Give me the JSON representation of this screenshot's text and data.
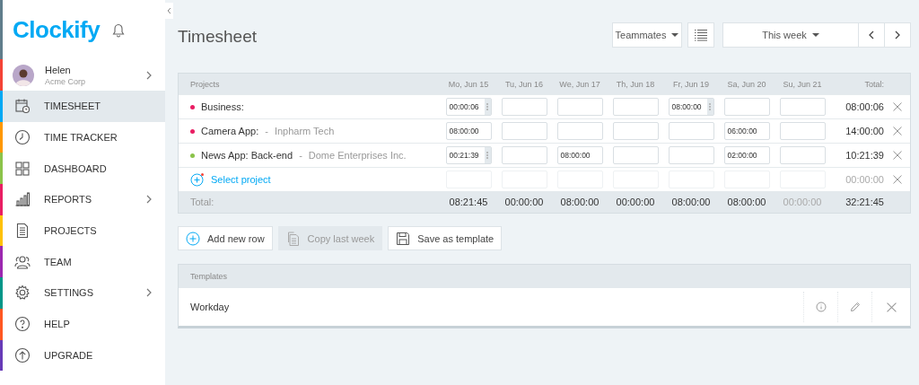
{
  "logo": {
    "text": "Clockify"
  },
  "user": {
    "name": "Helen",
    "company": "Acme Corp"
  },
  "nav": [
    {
      "label": "TIMESHEET",
      "selected": true,
      "submenu": false,
      "color": "#03a9f4"
    },
    {
      "label": "TIME TRACKER",
      "selected": false,
      "submenu": false,
      "color": "#ff9800"
    },
    {
      "label": "DASHBOARD",
      "selected": false,
      "submenu": false,
      "color": "#8bc34a"
    },
    {
      "label": "REPORTS",
      "selected": false,
      "submenu": true,
      "color": "#e91e63"
    },
    {
      "label": "PROJECTS",
      "selected": false,
      "submenu": false,
      "color": "#ffc107"
    },
    {
      "label": "TEAM",
      "selected": false,
      "submenu": false,
      "color": "#9c27b0"
    },
    {
      "label": "SETTINGS",
      "selected": false,
      "submenu": true,
      "color": "#009688"
    },
    {
      "label": "HELP",
      "selected": false,
      "submenu": false,
      "color": "#ff5722"
    },
    {
      "label": "UPGRADE",
      "selected": false,
      "submenu": false,
      "color": "#673ab7"
    }
  ],
  "page": {
    "title": "Timesheet"
  },
  "toolbar": {
    "filter": "Teammates",
    "range": "This week"
  },
  "table": {
    "project_header": "Projects",
    "days": [
      "Mo, Jun 15",
      "Tu, Jun 16",
      "We, Jun 17",
      "Th, Jun 18",
      "Fr, Jun 19",
      "Sa, Jun 20",
      "Su, Jun 21"
    ],
    "total_header": "Total:",
    "rows": [
      {
        "kind": "project",
        "name": "Business:",
        "color": "#e91e63",
        "total": "08:00:06",
        "cells": [
          {
            "value": "00:00:06",
            "stepper": true
          },
          {
            "stepper": false
          },
          {
            "stepper": false
          },
          {
            "stepper": false
          },
          {
            "value": "08:00:00",
            "stepper": true
          },
          {
            "stepper": false
          },
          {
            "stepper": false
          }
        ]
      },
      {
        "kind": "project",
        "name": "Camera App:",
        "separator": "-",
        "client": "Inpharm Tech",
        "color": "#e91e63",
        "total": "14:00:00",
        "cells": [
          {
            "value": "08:00:00",
            "stepper": false
          },
          {
            "stepper": false
          },
          {
            "stepper": false
          },
          {
            "stepper": false
          },
          {
            "stepper": false
          },
          {
            "value": "06:00:00",
            "stepper": false
          },
          {
            "stepper": false
          }
        ]
      },
      {
        "kind": "project",
        "name": "News App: Back-end",
        "separator": "-",
        "client": "Dome Enterprises Inc.",
        "color": "#8bc34a",
        "total": "10:21:39",
        "cells": [
          {
            "value": "00:21:39",
            "stepper": true
          },
          {
            "stepper": false
          },
          {
            "value": "08:00:00",
            "stepper": false
          },
          {
            "stepper": false
          },
          {
            "stepper": false
          },
          {
            "value": "02:00:00",
            "stepper": false
          },
          {
            "stepper": false
          }
        ]
      },
      {
        "kind": "select",
        "name": "Select project",
        "total": "00:00:00",
        "cells": [
          {
            "stepper": false
          },
          {
            "stepper": false
          },
          {
            "stepper": false
          },
          {
            "stepper": false
          },
          {
            "stepper": false
          },
          {
            "stepper": false
          },
          {
            "stepper": false
          }
        ]
      }
    ],
    "totals_label": "Total:",
    "totals": [
      {
        "value": "08:21:45",
        "muted": false
      },
      {
        "value": "00:00:00",
        "muted": false
      },
      {
        "value": "08:00:00",
        "muted": false
      },
      {
        "value": "00:00:00",
        "muted": false
      },
      {
        "value": "08:00:00",
        "muted": false
      },
      {
        "value": "08:00:00",
        "muted": false
      },
      {
        "value": "00:00:00",
        "muted": true
      }
    ],
    "grand_total": "32:21:45"
  },
  "actions": [
    {
      "label": "Add new row",
      "disabled": false
    },
    {
      "label": "Copy last week",
      "disabled": true
    },
    {
      "label": "Save as template",
      "disabled": false
    }
  ],
  "templates": {
    "header": "Templates",
    "items": [
      {
        "name": "Workday"
      }
    ]
  }
}
